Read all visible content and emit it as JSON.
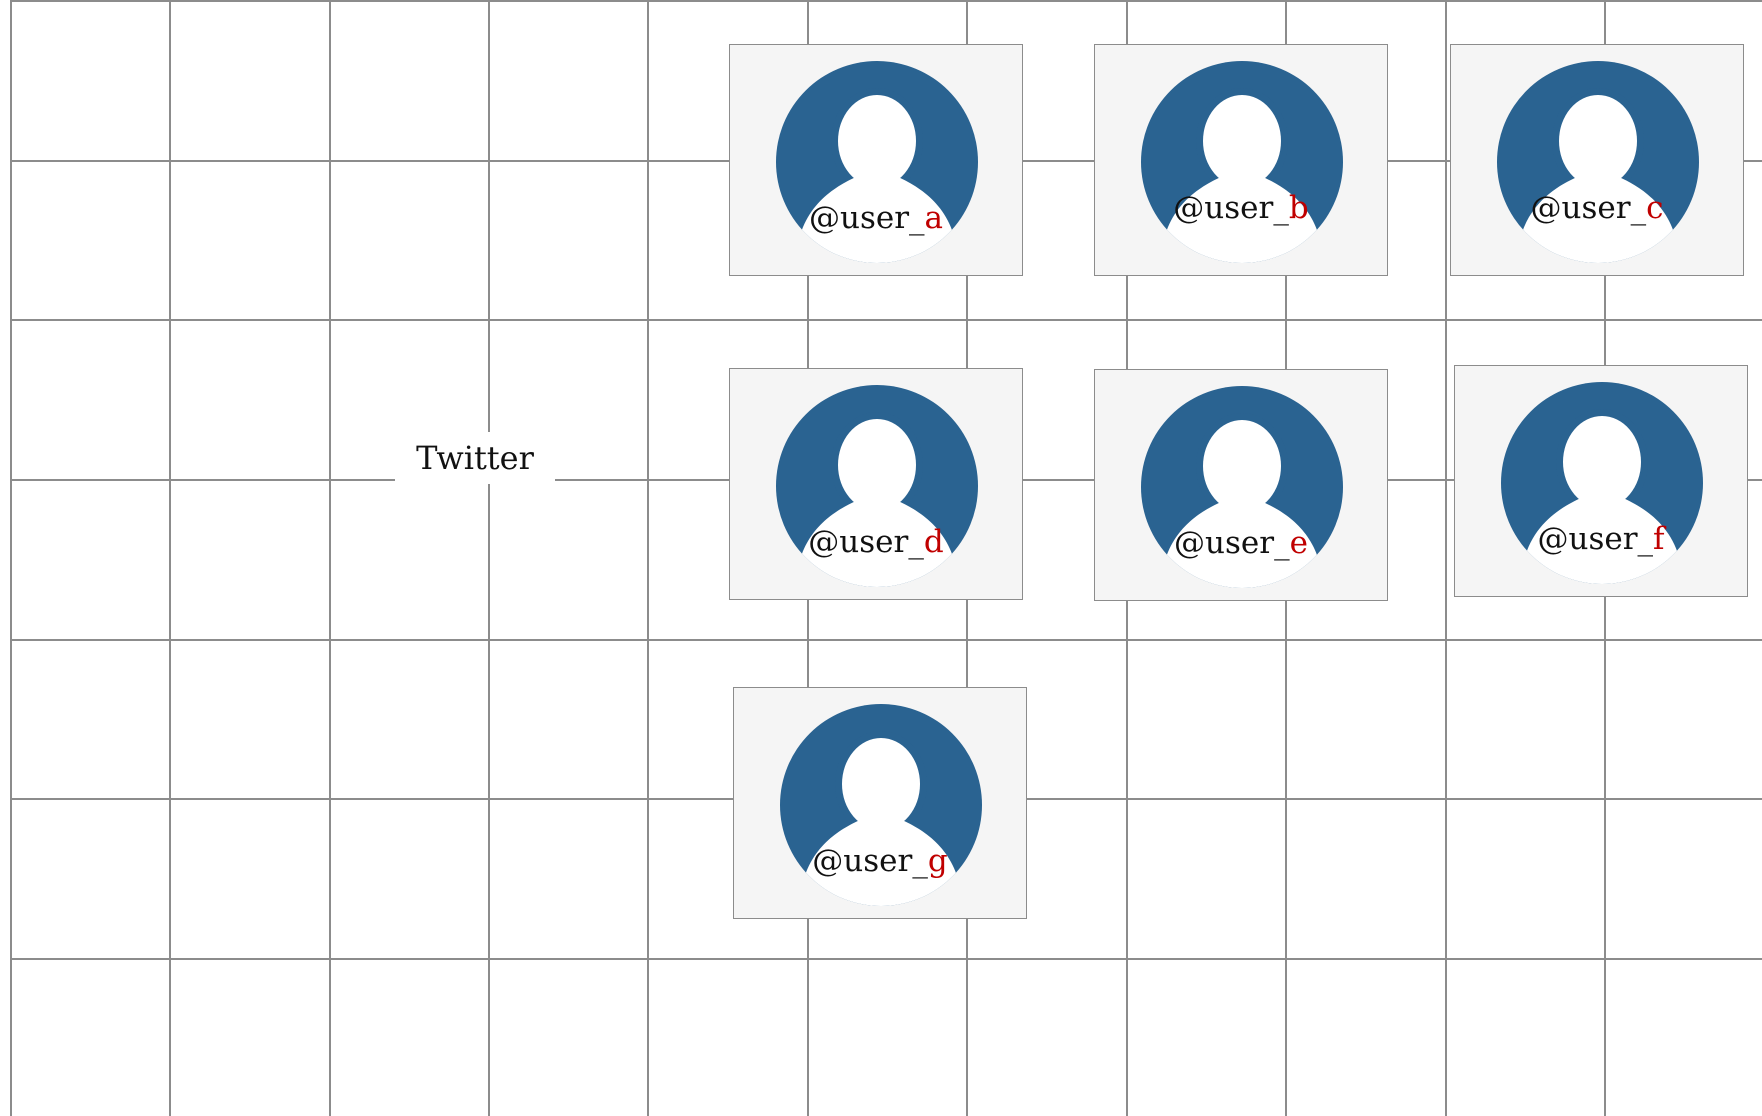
{
  "diagram": {
    "root_label": "Twitter",
    "users": [
      {
        "prefix": "@user_",
        "suffix": "a"
      },
      {
        "prefix": "@user_",
        "suffix": "b"
      },
      {
        "prefix": "@user_",
        "suffix": "c"
      },
      {
        "prefix": "@user_",
        "suffix": "d"
      },
      {
        "prefix": "@user_",
        "suffix": "e"
      },
      {
        "prefix": "@user_",
        "suffix": "f"
      },
      {
        "prefix": "@user_",
        "suffix": "g"
      }
    ],
    "colors": {
      "grid_line": "#8c8c8c",
      "card_fill": "#f5f5f5",
      "avatar_blue": "#2a6391",
      "suffix_red": "#c00000",
      "text": "#111111"
    },
    "icon": "user-avatar-icon"
  }
}
